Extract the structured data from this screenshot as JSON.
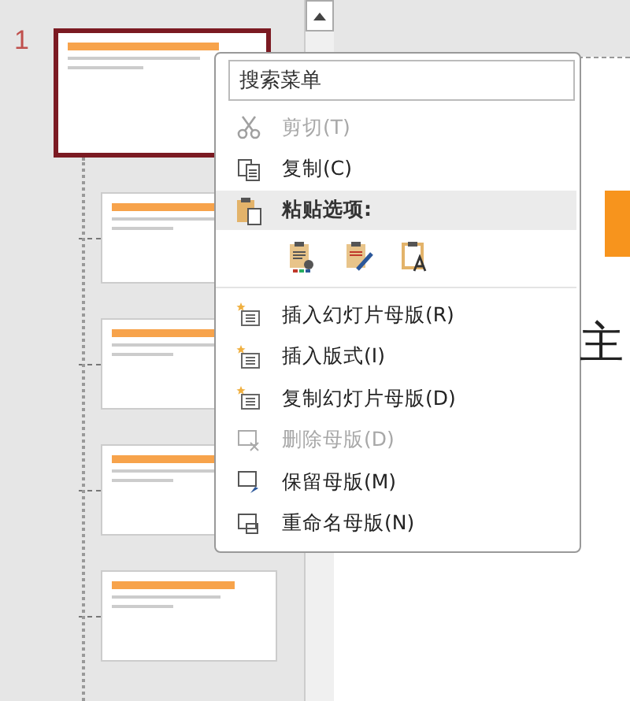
{
  "slide_pane": {
    "slide_number": "1",
    "thumbnails": [
      {
        "selected": true,
        "kind": "master"
      },
      {
        "selected": false,
        "kind": "layout"
      },
      {
        "selected": false,
        "kind": "layout"
      },
      {
        "selected": false,
        "kind": "layout"
      },
      {
        "selected": false,
        "kind": "layout"
      }
    ]
  },
  "editor": {
    "title_fragment": "主"
  },
  "context_menu": {
    "search": {
      "placeholder": "搜索菜单"
    },
    "items": [
      {
        "kind": "command",
        "label": "剪切(T)",
        "disabled": true
      },
      {
        "kind": "command",
        "label": "复制(C)",
        "disabled": false
      },
      {
        "kind": "header",
        "label": "粘贴选项:"
      },
      {
        "kind": "paste-options"
      },
      {
        "kind": "command",
        "label": "插入幻灯片母版(R)",
        "disabled": false
      },
      {
        "kind": "command",
        "label": "插入版式(I)",
        "disabled": false
      },
      {
        "kind": "command",
        "label": "复制幻灯片母版(D)",
        "disabled": false
      },
      {
        "kind": "command",
        "label": "删除母版(D)",
        "disabled": true
      },
      {
        "kind": "command",
        "label": "保留母版(M)",
        "disabled": false
      },
      {
        "kind": "command",
        "label": "重命名母版(N)",
        "disabled": false
      }
    ]
  }
}
